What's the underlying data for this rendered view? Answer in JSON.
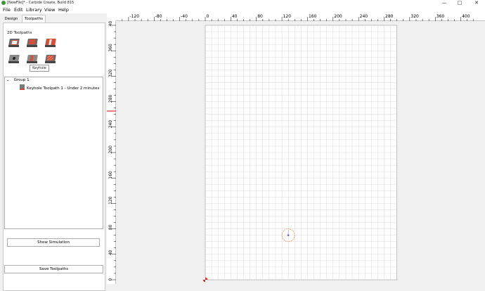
{
  "window": {
    "title": "[NewFile]* - Carbide Create, Build 815",
    "minimize": "—",
    "maximize": "□",
    "close": "✕"
  },
  "menu": [
    "File",
    "Edit",
    "Library",
    "View",
    "Help"
  ],
  "tabs": {
    "design": "Design",
    "toolpaths": "Toolpaths"
  },
  "toolpaths_section": {
    "label": "2D Toolpaths",
    "tools": [
      "contour",
      "pocket",
      "v-carve",
      "drill",
      "keyhole",
      "texture"
    ],
    "tooltip": "Keyhole"
  },
  "tree": {
    "group": "Group 1",
    "item": "Keyhole Toolpath 1 - Under 2 minutes"
  },
  "simulation": {
    "label": "Simulation",
    "button": "Show Simulation"
  },
  "save_button": "Save Toolpaths",
  "rulers": {
    "x_ticks": [
      "-120",
      "-80",
      "-40",
      "0",
      "40",
      "80",
      "120",
      "160",
      "200",
      "240",
      "280",
      "320",
      "360",
      "400"
    ],
    "y_ticks": [
      "400",
      "360",
      "320",
      "280",
      "240",
      "200",
      "160",
      "120",
      "80",
      "40",
      "0"
    ]
  },
  "canvas": {
    "stock_width": 300,
    "stock_height": 400,
    "keyhole_center": [
      130,
      70
    ],
    "keyhole_radius": 10,
    "stock_color": "#ffffff",
    "grid_color": "#d9d9d9",
    "keyhole_color": "#ff7f2a"
  }
}
